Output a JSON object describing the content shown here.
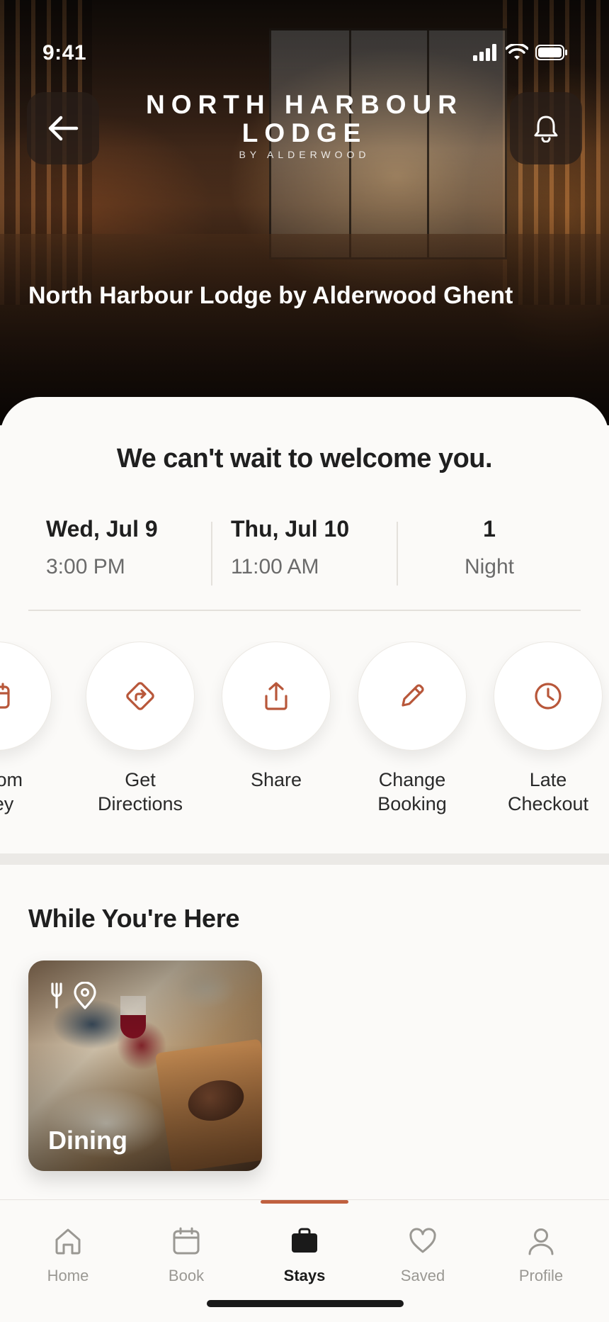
{
  "status_bar": {
    "time": "9:41"
  },
  "header": {
    "brand_name_line1": "NORTH HARBOUR",
    "brand_name_line2": "LODGE",
    "brand_sub": "BY ALDERWOOD",
    "hotel_title": "North Harbour Lodge by Alderwood Ghent",
    "back_icon": "arrow-left-icon",
    "notification_icon": "bell-icon"
  },
  "welcome": "We can't wait to welcome you.",
  "stay": {
    "check_in_date": "Wed, Jul 9",
    "check_in_time": "3:00 PM",
    "check_out_date": "Thu, Jul 10",
    "check_out_time": "11:00 AM",
    "nights_count": "1",
    "nights_label": "Night"
  },
  "actions": [
    {
      "label": "Room\nKey",
      "icon": "calendar-icon"
    },
    {
      "label": "Get\nDirections",
      "icon": "directions-icon"
    },
    {
      "label": "Share",
      "icon": "share-icon"
    },
    {
      "label": "Change\nBooking",
      "icon": "pencil-icon"
    },
    {
      "label": "Late\nCheckout",
      "icon": "clock-icon"
    }
  ],
  "while_here": {
    "title": "While You're Here",
    "cards": [
      {
        "label": "Dining",
        "icon": "dining-location-icon"
      }
    ]
  },
  "tabs": [
    {
      "label": "Home",
      "icon": "home-icon",
      "active": false
    },
    {
      "label": "Book",
      "icon": "calendar-icon",
      "active": false
    },
    {
      "label": "Stays",
      "icon": "briefcase-icon",
      "active": true
    },
    {
      "label": "Saved",
      "icon": "heart-icon",
      "active": false
    },
    {
      "label": "Profile",
      "icon": "person-icon",
      "active": false
    }
  ],
  "colors": {
    "accent": "#c0603f",
    "text": "#1f1f1f",
    "muted": "#6b6b6b",
    "background": "#fbfaf8"
  }
}
